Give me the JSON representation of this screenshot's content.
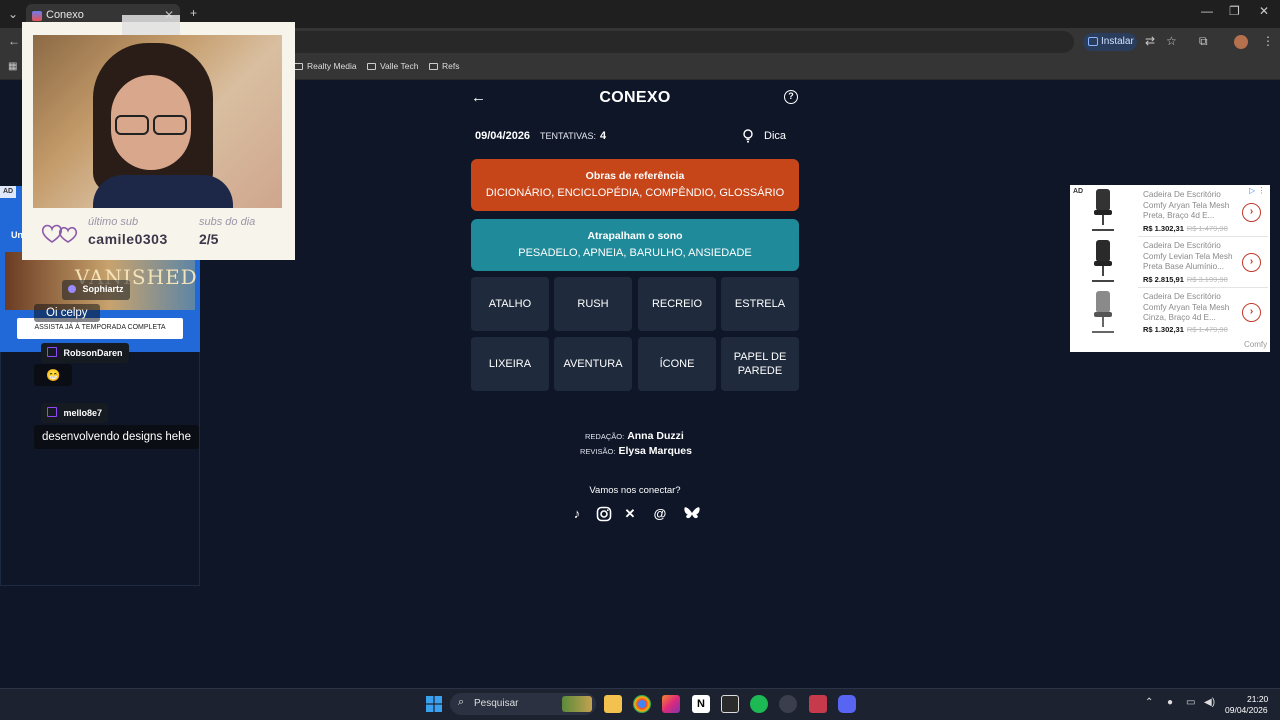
{
  "browser": {
    "tab_title": "Conexo",
    "install_label": "Instalar",
    "bookmarks": [
      "Realty Media",
      "Valle Tech",
      "Refs"
    ]
  },
  "conexo": {
    "title": "CONEXO",
    "date": "09/04/2026",
    "attempts_label": "TENTATIVAS:",
    "attempts_value": "4",
    "hint_label": "Dica",
    "groups": [
      {
        "title": "Obras de referência",
        "words": "DICIONÁRIO, ENCICLOPÉDIA, COMPÊNDIO, GLOSSÁRIO",
        "color": "#c6461a"
      },
      {
        "title": "Atrapalham o sono",
        "words": "PESADELO, APNEIA, BARULHO, ANSIEDADE",
        "color": "#1f8a9a"
      }
    ],
    "tiles": [
      "ATALHO",
      "RUSH",
      "RECREIO",
      "ESTRELA",
      "LIXEIRA",
      "AVENTURA",
      "ÍCONE",
      "PAPEL DE PAREDE"
    ],
    "credits": {
      "redacao_label": "REDAÇÃO:",
      "redacao": "Anna Duzzi",
      "revisao_label": "REVISÃO:",
      "revisao": "Elysa Marques"
    },
    "connect_label": "Vamos nos conectar?",
    "social_icons": [
      "tiktok-icon",
      "instagram-icon",
      "x-icon",
      "threads-icon",
      "bluesky-icon"
    ]
  },
  "stream_overlay": {
    "last_sub_label": "último sub",
    "last_sub_value": "camile0303",
    "subs_day_label": "subs do dia",
    "subs_day_value": "2/5"
  },
  "left_ad": {
    "tag": "AD",
    "partial_text": "Un",
    "brand": "VANISHED",
    "cta": "ASSISTA JÁ À TEMPORADA COMPLETA"
  },
  "chat": [
    {
      "user": "Sophiartz",
      "message": "Oi celpy"
    },
    {
      "user": "RobsonDaren",
      "message": "😁"
    },
    {
      "user": "mello8e7",
      "message": "desenvolvendo designs hehe"
    }
  ],
  "right_ad": {
    "tag": "AD",
    "brand": "Comfy",
    "items": [
      {
        "title": "Cadeira De Escritório Comfy Aryan Tela Mesh Preta, Braço 4d E...",
        "price": "R$ 1.302,31",
        "old_price": "R$ 1.479,90"
      },
      {
        "title": "Cadeira De Escritório Comfy Levian Tela Mesh Preta Base Alumínio...",
        "price": "R$ 2.815,91",
        "old_price": "R$ 3.199,90"
      },
      {
        "title": "Cadeira De Escritório Comfy Aryan Tela Mesh Cinza, Braço 4d E...",
        "price": "R$ 1.302,31",
        "old_price": "R$ 1.479,90"
      }
    ]
  },
  "taskbar": {
    "search_placeholder": "Pesquisar",
    "time": "21:20",
    "date": "09/04/2026"
  }
}
